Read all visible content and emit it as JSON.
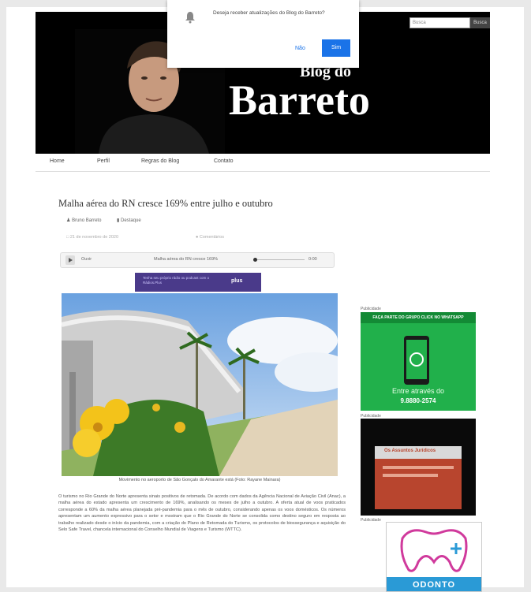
{
  "header": {
    "blog_do": "Blog do",
    "blog_barreto": "Barreto",
    "search_placeholder": "Busca",
    "search_button": "Busca"
  },
  "notification": {
    "text": "Deseja receber atualizações do Blog do Barreto?",
    "no_label": "Não",
    "yes_label": "Sim"
  },
  "nav": {
    "items": [
      {
        "label": "Home"
      },
      {
        "label": "Perfil"
      },
      {
        "label": "Regras do Blog"
      },
      {
        "label": "Contato"
      }
    ]
  },
  "post": {
    "title": "Malha aérea do RN cresce 169% entre julho e outubro",
    "author": "Bruno Barreto",
    "category": "Destaque",
    "date": "21 de novembro de 2020",
    "comments": "Comentários",
    "audio": {
      "listen_label": "Ouvir",
      "track_title": "Malha aérea do RN cresce 169%",
      "time": "0:00"
    },
    "ad_text": "Tenha seu próprio rádio ou podcast com o Rádios.Plus",
    "ad_brand": "plus",
    "photo_caption": "Movimento no aeroporto de São Gonçalo do Amarante está (Foto: Rayane Mainara)",
    "body": "O turismo no Rio Grande do Norte apresenta sinais positivos de retomada. De acordo com dados da Agência Nacional de Aviação Civil (Anac), a malha aérea do estado apresenta um crescimento de 169%, analisando os meses de julho a outubro. A oferta atual de voos praticados corresponde a 60% da malha aérea planejada pré-pandemia para o mês de outubro, considerando apenas os voos domésticos. Os números apresentam um aumento expressivo para o setor e mostram que o Rio Grande do Norte se consolida como destino seguro em resposta ao trabalho realizado desde o início da pandemia, com a criação do Plano de Retomada do Turismo, os protocolos de biossegurança e aquisição do Selo Safe Travel, chancela internacional do Conselho Mundial de Viagens e Turismo (WTTC)."
  },
  "sidebar": {
    "label1": "Publicidade",
    "whatsapp_top": "FAÇA PARTE DO GRUPO CLICK NO WHATSAPP",
    "whatsapp_text": "Entre através do",
    "whatsapp_number": "9.8880-2574",
    "label2": "Publicidade",
    "book_title": "Os Assuntos Jurídicos",
    "label3": "Publicidade",
    "odonto": "ODONTO"
  },
  "colors": {
    "header_bg": "#000000",
    "accent_blue": "#1a73e8",
    "whatsapp_green": "#21b04b",
    "odonto_blue": "#2a9ad6"
  }
}
